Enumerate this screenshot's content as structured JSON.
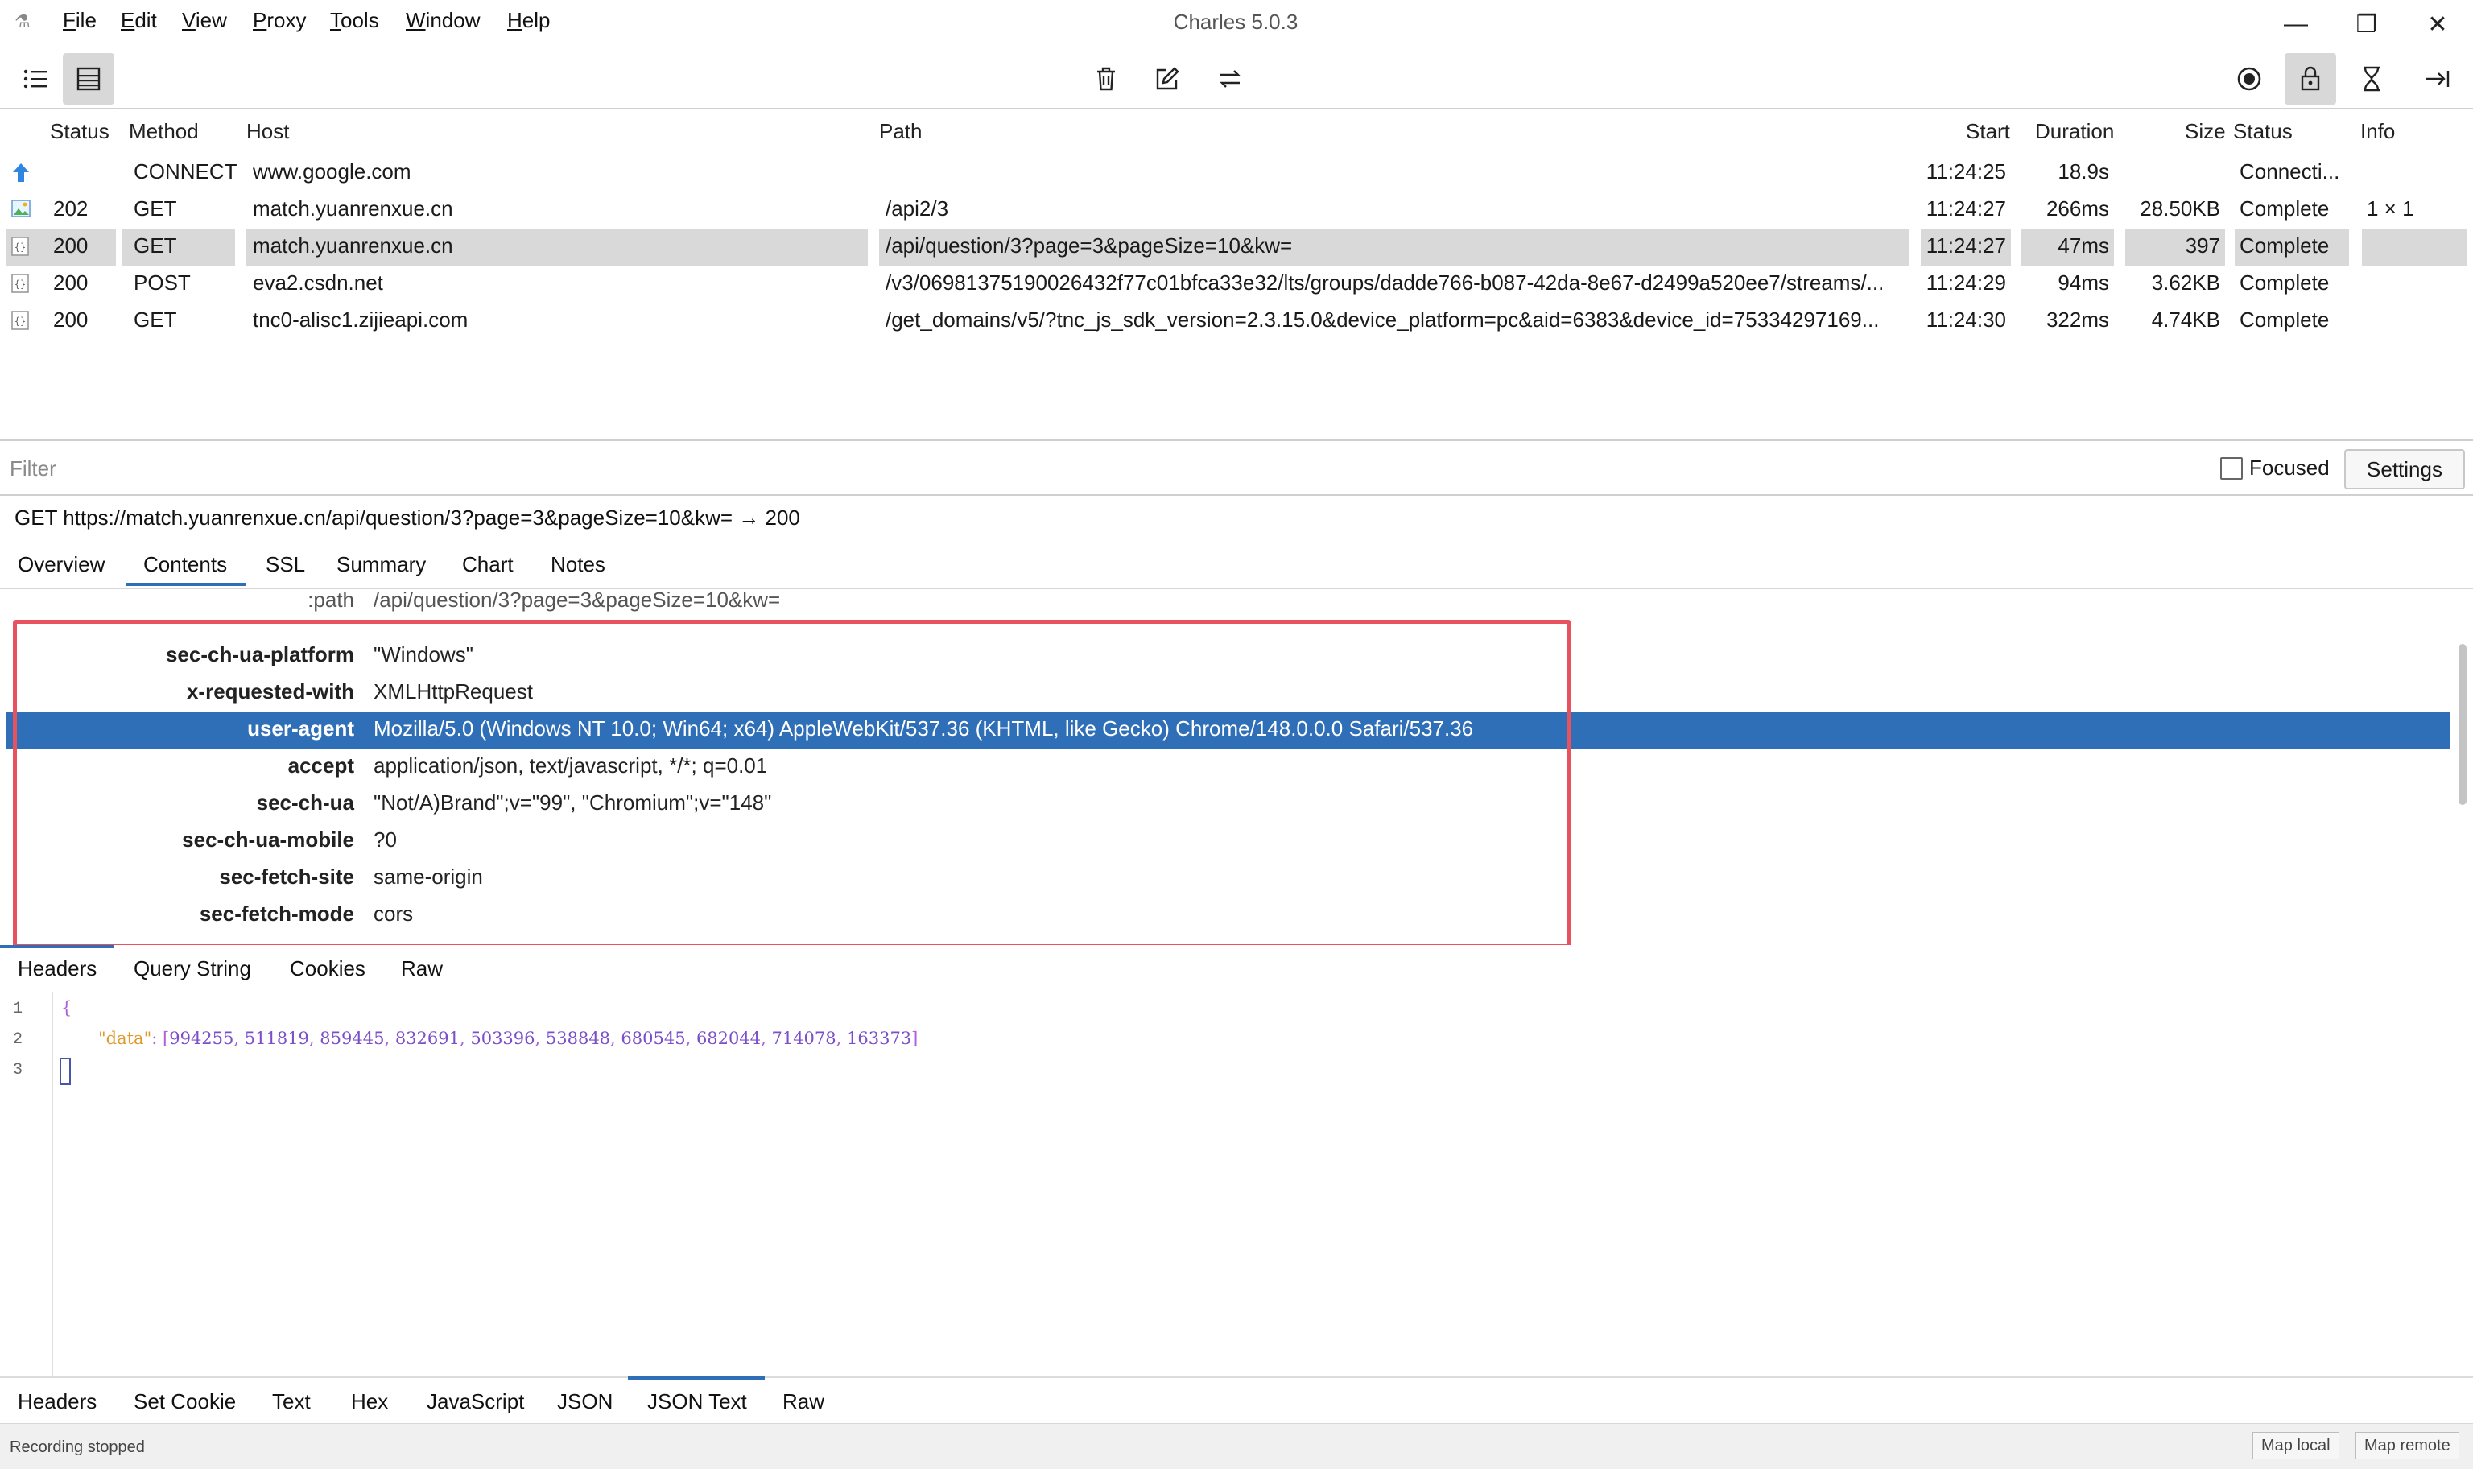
{
  "window": {
    "title": "Charles 5.0.3",
    "menu": [
      "File",
      "Edit",
      "View",
      "Proxy",
      "Tools",
      "Window",
      "Help"
    ],
    "menu_accel": [
      "F",
      "E",
      "V",
      "P",
      "T",
      "W",
      "H"
    ]
  },
  "sessions": {
    "columns": [
      "Status",
      "Method",
      "Host",
      "Path",
      "Start",
      "Duration",
      "Size",
      "Status",
      "Info"
    ],
    "rows": [
      {
        "status": "",
        "method": "CONNECT",
        "host": "www.google.com",
        "path": "",
        "start": "11:24:25",
        "duration": "18.9s",
        "size": "",
        "state": "Connecti...",
        "info": "",
        "icon": "upload-arrow-icon"
      },
      {
        "status": "202",
        "method": "GET",
        "host": "match.yuanrenxue.cn",
        "path": "/api2/3",
        "start": "11:24:27",
        "duration": "266ms",
        "size": "28.50KB",
        "state": "Complete",
        "info": "1 × 1",
        "icon": "image-file-icon"
      },
      {
        "status": "200",
        "method": "GET",
        "host": "match.yuanrenxue.cn",
        "path": "/api/question/3?page=3&pageSize=10&kw=",
        "start": "11:24:27",
        "duration": "47ms",
        "size": "397",
        "state": "Complete",
        "info": "",
        "icon": "json-file-icon"
      },
      {
        "status": "200",
        "method": "POST",
        "host": "eva2.csdn.net",
        "path": "/v3/06981375190026432f77c01bfca33e32/lts/groups/dadde766-b087-42da-8e67-d2499a520ee7/streams/...",
        "start": "11:24:29",
        "duration": "94ms",
        "size": "3.62KB",
        "state": "Complete",
        "info": "",
        "icon": "json-file-icon"
      },
      {
        "status": "200",
        "method": "GET",
        "host": "tnc0-alisc1.zijieapi.com",
        "path": "/get_domains/v5/?tnc_js_sdk_version=2.3.15.0&device_platform=pc&aid=6383&device_id=75334297169...",
        "start": "11:24:30",
        "duration": "322ms",
        "size": "4.74KB",
        "state": "Complete",
        "info": "",
        "icon": "json-file-icon"
      }
    ]
  },
  "filter": {
    "placeholder": "Filter",
    "focused_label": "Focused",
    "settings_label": "Settings"
  },
  "request_line": "GET https://match.yuanrenxue.cn/api/question/3?page=3&pageSize=10&kw=  → 200",
  "detail_tabs": [
    "Overview",
    "Contents",
    "SSL",
    "Summary",
    "Chart",
    "Notes"
  ],
  "active_detail_tab": "Contents",
  "headers": {
    "partial_top": {
      "key": ":path",
      "value": "/api/question/3?page=3&pageSize=10&kw="
    },
    "rows": [
      {
        "key": "sec-ch-ua-platform",
        "value": "\"Windows\""
      },
      {
        "key": "x-requested-with",
        "value": "XMLHttpRequest"
      },
      {
        "key": "user-agent",
        "value": "Mozilla/5.0 (Windows NT 10.0; Win64; x64) AppleWebKit/537.36 (KHTML, like Gecko) Chrome/148.0.0.0 Safari/537.36"
      },
      {
        "key": "accept",
        "value": "application/json, text/javascript, */*; q=0.01"
      },
      {
        "key": "sec-ch-ua",
        "value": "\"Not/A)Brand\";v=\"99\", \"Chromium\";v=\"148\""
      },
      {
        "key": "sec-ch-ua-mobile",
        "value": "?0"
      },
      {
        "key": "sec-fetch-site",
        "value": "same-origin"
      },
      {
        "key": "sec-fetch-mode",
        "value": "cors"
      }
    ]
  },
  "request_tabs": [
    "Headers",
    "Query String",
    "Cookies",
    "Raw"
  ],
  "code": {
    "line_numbers": [
      "1",
      "2",
      "3"
    ],
    "open_brace": "{",
    "key": "\"data\"",
    "colon": ": ",
    "open_bracket": "[",
    "values": [
      "994255",
      "511819",
      "859445",
      "832691",
      "503396",
      "538848",
      "680545",
      "682044",
      "714078",
      "163373"
    ],
    "close_bracket": "]"
  },
  "response_tabs": [
    "Headers",
    "Set Cookie",
    "Text",
    "Hex",
    "JavaScript",
    "JSON",
    "JSON Text",
    "Raw"
  ],
  "active_response_tab": "JSON Text",
  "statusbar": {
    "text": "Recording stopped",
    "map_local": "Map local",
    "map_remote": "Map remote"
  }
}
